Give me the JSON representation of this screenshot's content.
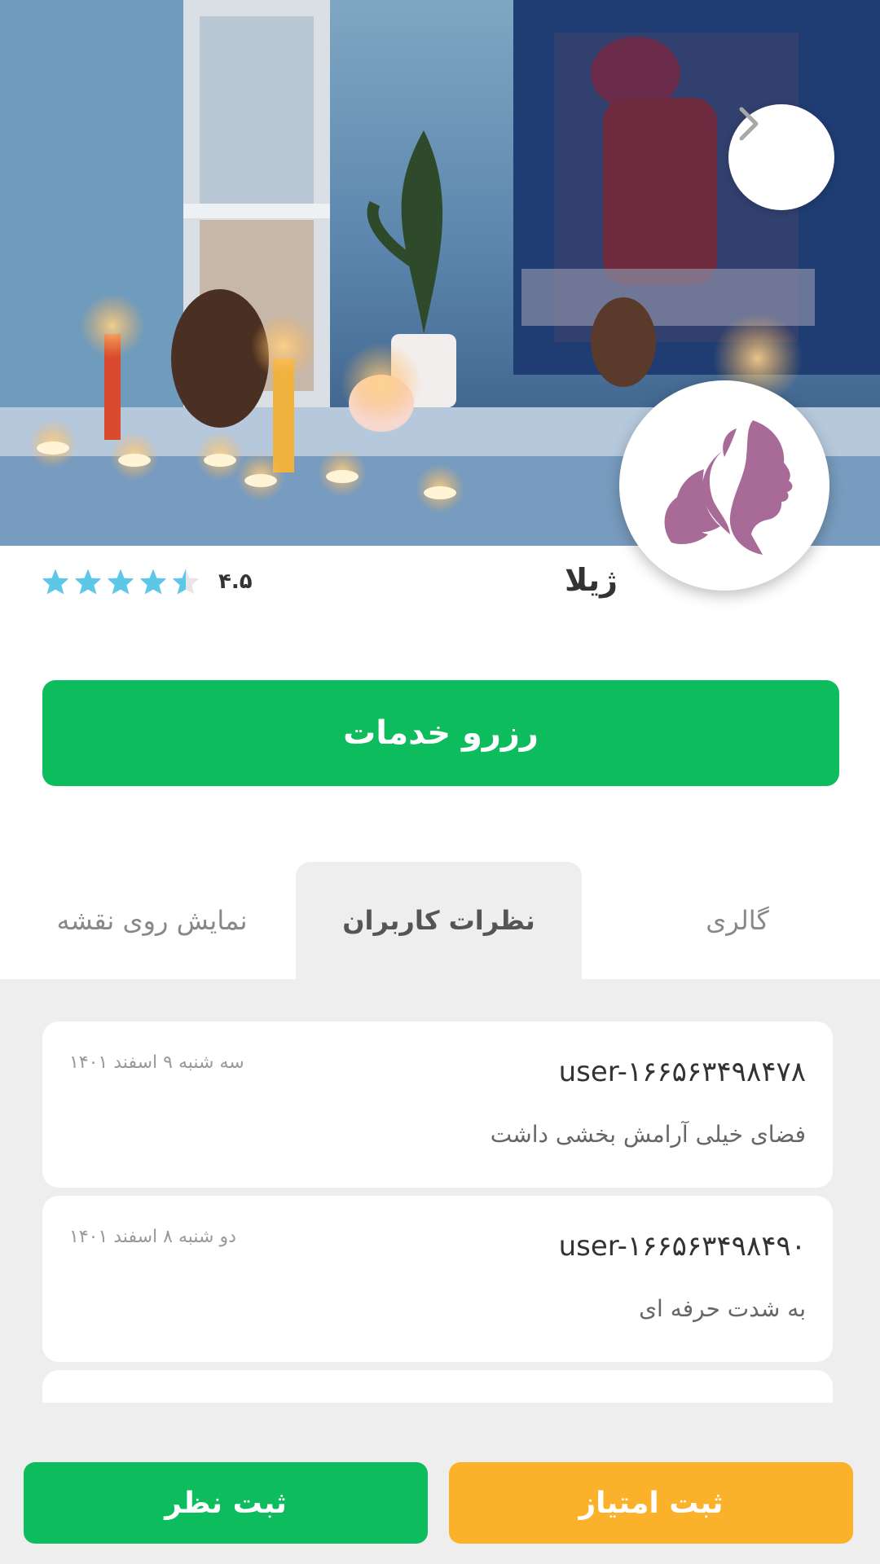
{
  "header": {
    "next_icon": "chevron-right-icon",
    "logo_icon": "lotus-woman-profile-icon",
    "logo_color": "#a86a96"
  },
  "salon": {
    "name": "ژیلا",
    "rating_value": 4.5,
    "rating_text": "۴.۵",
    "star_color": "#5cc7e6"
  },
  "actions": {
    "book_label": "رزرو خدمات"
  },
  "tabs": [
    {
      "label": "گالری",
      "active": false
    },
    {
      "label": "نظرات کاربران",
      "active": true
    },
    {
      "label": "نمایش روی نقشه",
      "active": false
    }
  ],
  "reviews": [
    {
      "user": "user-۱۶۶۵۶۳۴۹۸۴۷۸",
      "date": "سه شنبه ۹ اسفند ۱۴۰۱",
      "text": "فضای خیلی آرامش بخشی داشت"
    },
    {
      "user": "user-۱۶۶۵۶۳۴۹۸۴۹۰",
      "date": "دو شنبه ۸ اسفند ۱۴۰۱",
      "text": "به شدت حرفه ای"
    }
  ],
  "bottom": {
    "comment_label": "ثبت نظر",
    "rate_label": "ثبت امتیاز",
    "comment_color": "#0dbc5d",
    "rate_color": "#fcb12b"
  }
}
